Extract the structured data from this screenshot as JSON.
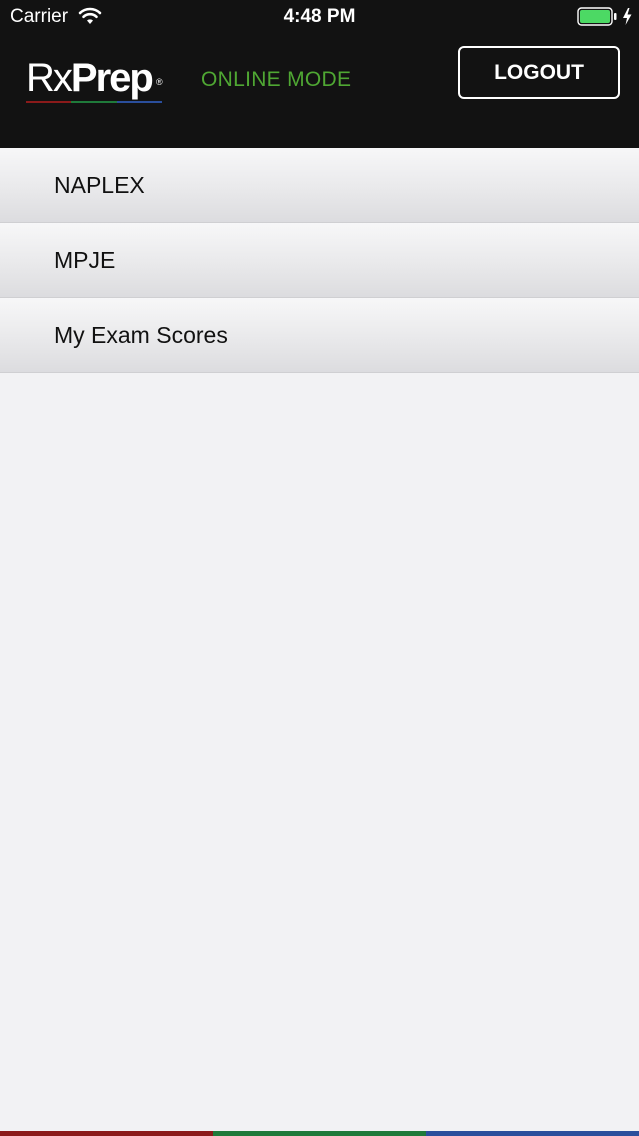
{
  "status_bar": {
    "carrier": "Carrier",
    "time": "4:48 PM",
    "battery_level": 1.0
  },
  "header": {
    "logo": "RxPrep",
    "mode": "ONLINE MODE",
    "logout_label": "LOGOUT"
  },
  "menu": {
    "items": [
      {
        "label": "NAPLEX"
      },
      {
        "label": "MPJE"
      },
      {
        "label": "My Exam Scores"
      }
    ]
  },
  "colors": {
    "header_bg": "#121212",
    "mode_green": "#4fa733",
    "brand_red": "#8b1a1a",
    "brand_green": "#1f7a3a",
    "brand_blue": "#2a4e9c",
    "battery_green": "#4cd964"
  }
}
